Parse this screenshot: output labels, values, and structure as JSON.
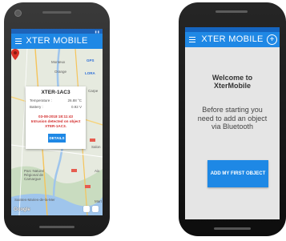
{
  "app": {
    "title": "XTER MOBILE"
  },
  "left_phone": {
    "map_labels": {
      "gps": "GPS",
      "lora": "LORA",
      "orange": "Orange",
      "monteux": "Monteux",
      "carpentras": "Carpe",
      "salon": "Salon",
      "aix": "Aix",
      "camargue_1": "Parc Naturel",
      "camargue_2": "Régional de",
      "camargue_3": "Camargue",
      "saintes": "Saintes-Maries-de-la-Mer",
      "martigues": "Mart",
      "google": "Google"
    },
    "popup": {
      "title": "XTER-1AC3",
      "rows": [
        {
          "label": "Temperature :",
          "value": "26.88 °C"
        },
        {
          "label": "Battery :",
          "value": "0.92 V"
        }
      ],
      "alert_line1": "03-08-2018 18:11:43",
      "alert_line2": "Intrusion detected on object",
      "alert_line3": "XTER-1AC3.",
      "details_label": "DETAILS"
    }
  },
  "right_phone": {
    "welcome_line1": "Welcome to",
    "welcome_line2": "XterMobile",
    "body_line1": "Before starting you",
    "body_line2": "need to add an object",
    "body_line3": "via Bluetooth",
    "add_button_label": "ADD MY FIRST OBJECT"
  },
  "icons": {
    "menu": "hamburger-menu-icon",
    "logo_o": "signal-o-icon",
    "plus": "plus-icon",
    "pin": "map-pin-icon"
  },
  "colors": {
    "appbar": "#1f88e5",
    "statusbar": "#1e63b8",
    "alert": "#d32f2f",
    "button": "#1e88e5"
  }
}
